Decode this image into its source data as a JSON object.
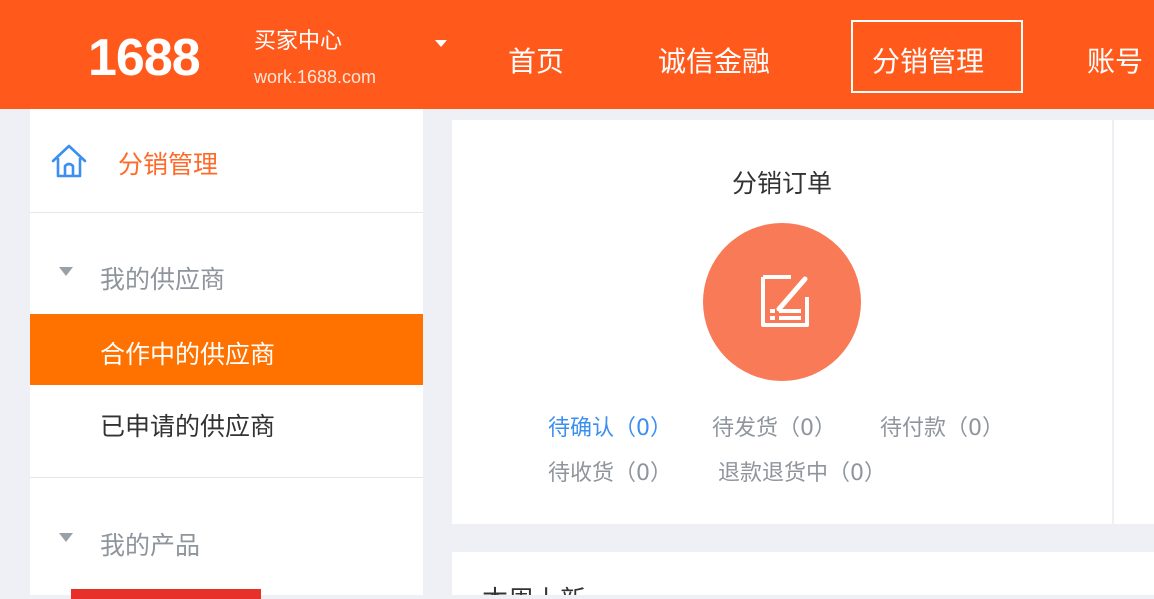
{
  "header": {
    "logo_number": "1688",
    "logo_title": "买家中心",
    "logo_domain": "work.1688.com",
    "nav": [
      {
        "label": "首页"
      },
      {
        "label": "诚信金融"
      },
      {
        "label": "分销管理",
        "active": true
      },
      {
        "label": "账号"
      }
    ]
  },
  "sidebar": {
    "home_label": "分销管理",
    "sections": [
      {
        "label": "我的供应商",
        "items": [
          {
            "label": "合作中的供应商",
            "active": true
          },
          {
            "label": "已申请的供应商"
          }
        ]
      },
      {
        "label": "我的产品"
      }
    ]
  },
  "order_card": {
    "title": "分销订单",
    "stats": [
      {
        "label": "待确认（0）",
        "highlight": true
      },
      {
        "label": "待发货（0）"
      },
      {
        "label": "待付款（0）"
      },
      {
        "label": "待收货（0）"
      },
      {
        "label": "退款退货中（0）"
      }
    ]
  },
  "second_card": {
    "title": "本周上新"
  },
  "colors": {
    "brand": "#ff5a1c",
    "active_item": "#ff7200",
    "icon_circle": "#f97a56",
    "link_blue": "#3b8ff0"
  }
}
